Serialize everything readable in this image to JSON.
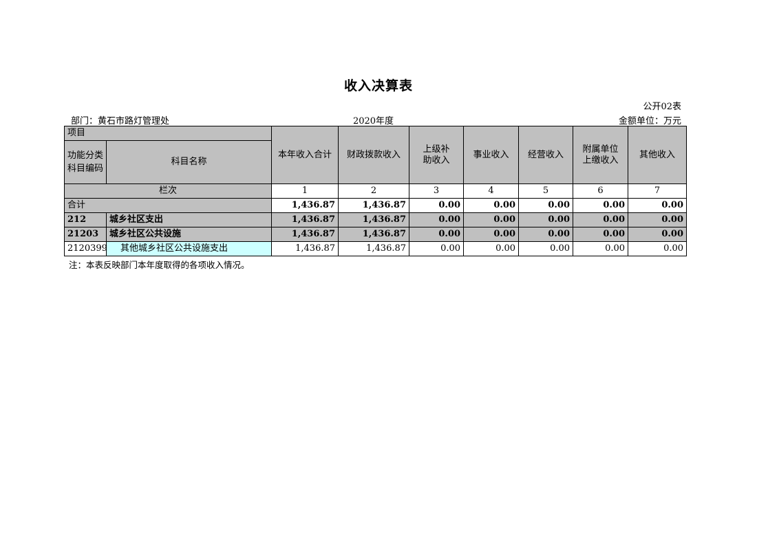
{
  "title": "收入决算表",
  "table_no": "公开02表",
  "department": "部门：黄石市路灯管理处",
  "year": "2020年度",
  "unit": "金额单位：万元",
  "header": {
    "project": "项目",
    "func_code": "功能分类科目编码",
    "subject_name": "科目名称",
    "col_total": "本年收入合计",
    "col_fiscal": "财政拨款收入",
    "col_superior": "上级补助收入",
    "col_business": "事业收入",
    "col_operating": "经营收入",
    "col_affiliated": "附属单位上缴收入",
    "col_other": "其他收入"
  },
  "column_index": {
    "label": "栏次",
    "numbers": [
      "1",
      "2",
      "3",
      "4",
      "5",
      "6",
      "7"
    ]
  },
  "rows": [
    {
      "code": "合计",
      "name": "",
      "values": [
        "1,436.87",
        "1,436.87",
        "0.00",
        "0.00",
        "0.00",
        "0.00",
        "0.00"
      ]
    },
    {
      "code": "212",
      "name": "城乡社区支出",
      "values": [
        "1,436.87",
        "1,436.87",
        "0.00",
        "0.00",
        "0.00",
        "0.00",
        "0.00"
      ]
    },
    {
      "code": "21203",
      "name": "城乡社区公共设施",
      "values": [
        "1,436.87",
        "1,436.87",
        "0.00",
        "0.00",
        "0.00",
        "0.00",
        "0.00"
      ]
    },
    {
      "code": "2120399",
      "name": "其他城乡社区公共设施支出",
      "values": [
        "1,436.87",
        "1,436.87",
        "0.00",
        "0.00",
        "0.00",
        "0.00",
        "0.00"
      ]
    }
  ],
  "note": "注：本表反映部门本年度取得的各项收入情况。"
}
